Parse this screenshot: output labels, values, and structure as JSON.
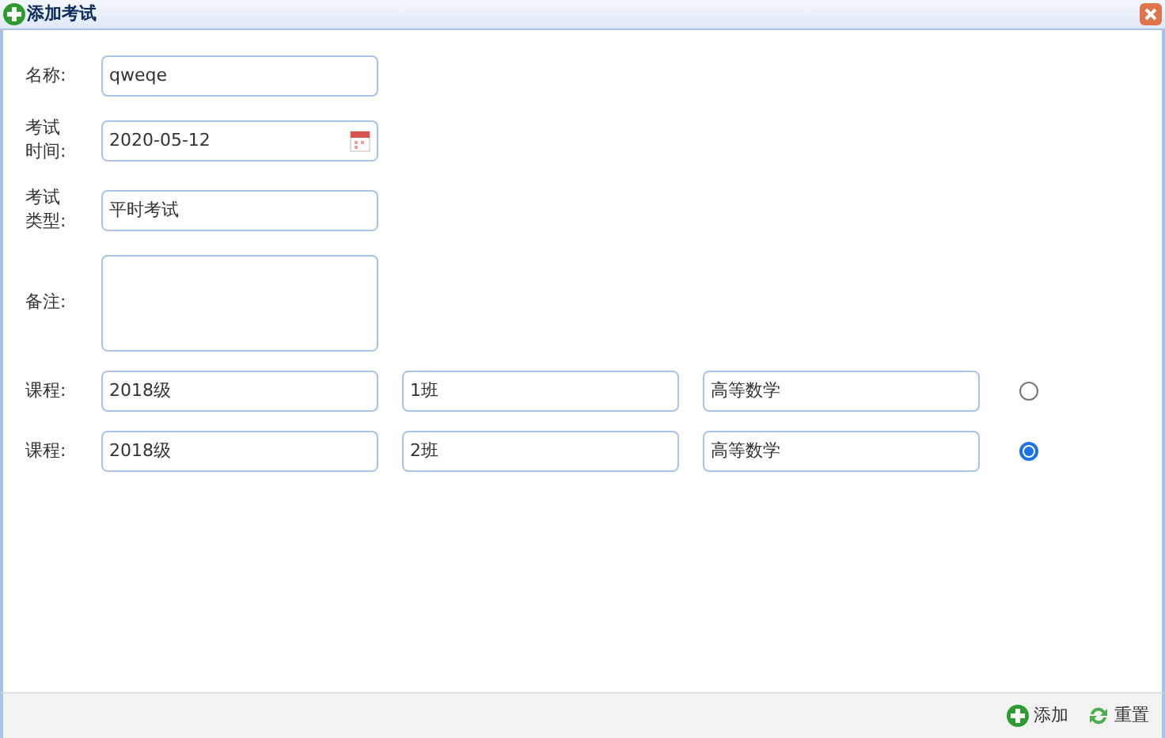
{
  "window": {
    "title": "添加考试"
  },
  "fields": [
    {
      "kind": "text",
      "label": "名称:",
      "value": "qweqe"
    },
    {
      "kind": "date",
      "label": "考试时间:",
      "value": "2020-05-12"
    },
    {
      "kind": "text",
      "label": "考试类型:",
      "value": "平时考试"
    },
    {
      "kind": "textarea",
      "label": "备注:"
    }
  ],
  "courses": [
    {
      "label": "课程:",
      "grade": "2018级",
      "class": "1班",
      "subject": "高等数学",
      "selected": false
    },
    {
      "label": "课程:",
      "grade": "2018级",
      "class": "2班",
      "subject": "高等数学",
      "selected": true
    }
  ],
  "buttons": [
    {
      "kind": "add",
      "label": "添加"
    },
    {
      "kind": "reset",
      "label": "重置"
    }
  ]
}
